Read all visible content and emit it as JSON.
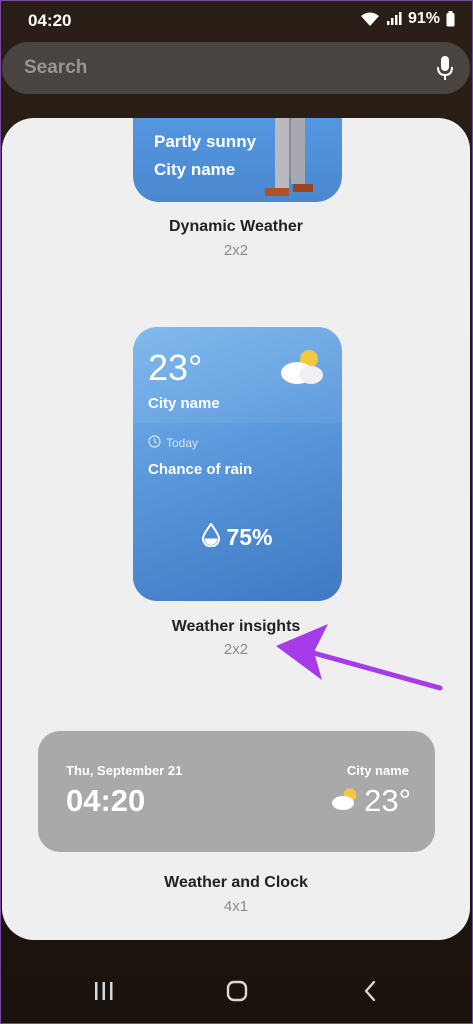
{
  "status_bar": {
    "time": "04:20",
    "battery": "91%"
  },
  "search": {
    "placeholder": "Search"
  },
  "widgets": [
    {
      "name": "Dynamic Weather",
      "size": "2x2",
      "preview": {
        "condition": "Partly sunny",
        "city": "City name"
      }
    },
    {
      "name": "Weather insights",
      "size": "2x2",
      "preview": {
        "temperature": "23°",
        "city": "City name",
        "day": "Today",
        "rain_label": "Chance of rain",
        "rain_percent": "75%"
      }
    },
    {
      "name": "Weather and Clock",
      "size": "4x1",
      "preview": {
        "date": "Thu, September 21",
        "time": "04:20",
        "city": "City name",
        "temperature": "23°"
      }
    }
  ],
  "colors": {
    "accent_arrow": "#a63ce8",
    "insights_card": "#5a98dc",
    "clock_card": "#a9a9a9",
    "sheet": "#efeff0"
  },
  "icons": {
    "nav_recent": "recent-apps-icon",
    "nav_home": "home-icon",
    "nav_back": "back-icon"
  }
}
